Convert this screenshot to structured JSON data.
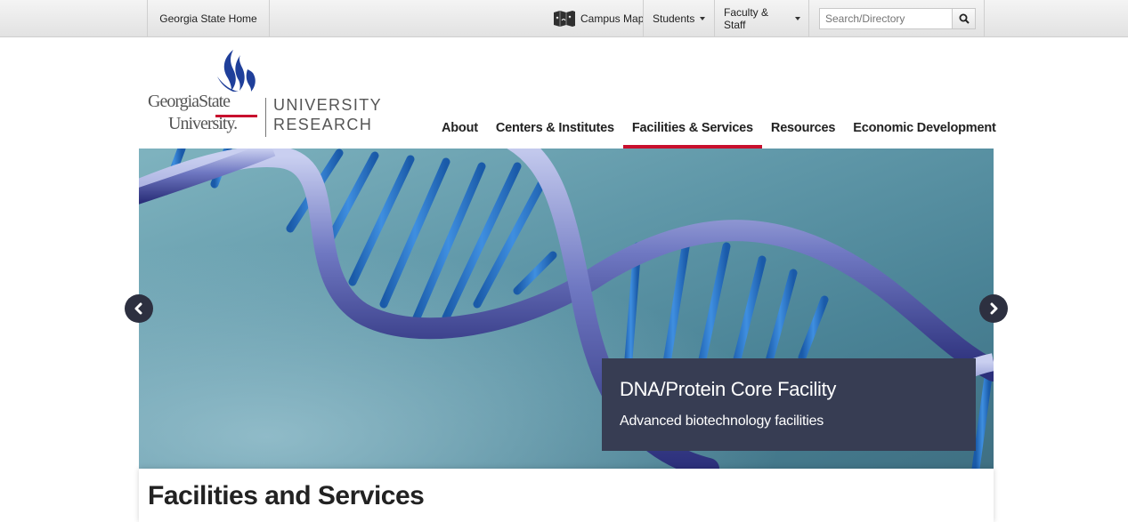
{
  "topbar": {
    "home_label": "Georgia State Home",
    "campus_map_label": "Campus Map",
    "students_label": "Students",
    "faculty_staff_label": "Faculty & Staff",
    "search_placeholder": "Search/Directory"
  },
  "logo": {
    "line1": "GeorgiaState",
    "line2": "University.",
    "unit_line1": "UNIVERSITY",
    "unit_line2": "RESEARCH",
    "colors": {
      "blue": "#1f3f9a",
      "red": "#c8102e",
      "gray": "#555555"
    }
  },
  "nav": {
    "items": [
      {
        "label": "About",
        "active": false
      },
      {
        "label": "Centers & Institutes",
        "active": false
      },
      {
        "label": "Facilities & Services",
        "active": true
      },
      {
        "label": "Resources",
        "active": false
      },
      {
        "label": "Economic Development",
        "active": false
      }
    ],
    "active_color": "#c8102e"
  },
  "hero": {
    "image": "dna-double-helix",
    "caption_title": "DNA/Protein Core Facility",
    "caption_subtitle": "Advanced biotechnology facilities",
    "caption_bg": "#373d53",
    "prev_icon": "chevron-left-icon",
    "next_icon": "chevron-right-icon"
  },
  "content": {
    "title": "Facilities and Services"
  }
}
